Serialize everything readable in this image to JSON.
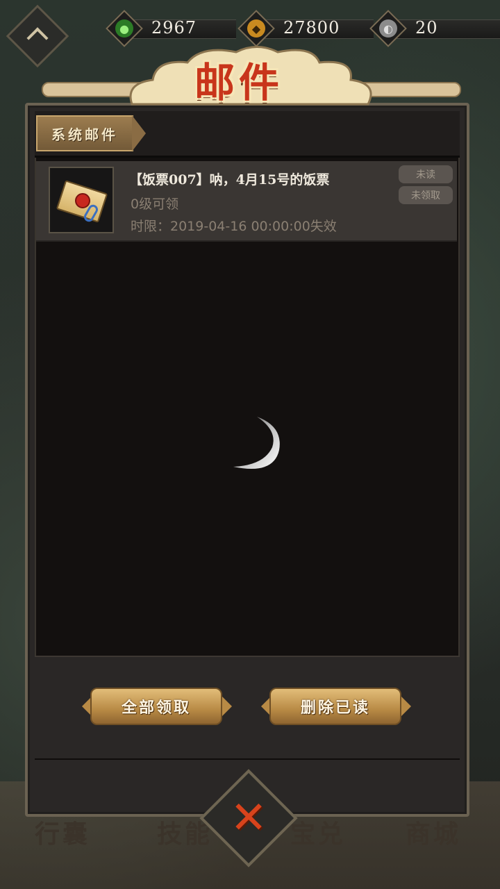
{
  "header": {
    "title": "邮件",
    "resources": [
      {
        "icon": "leaf-gem-icon",
        "color": "#4caf3c",
        "value": "2967"
      },
      {
        "icon": "gold-coin-icon",
        "color": "#d99a2b",
        "value": "27800"
      },
      {
        "icon": "silver-coin-icon",
        "color": "#8c8c8c",
        "value": "20"
      }
    ]
  },
  "tabs": [
    {
      "label": "系统邮件"
    }
  ],
  "mail": {
    "title": "【饭票007】呐，4月15号的饭票",
    "level": "0级可领",
    "expire": "时限：2019-04-16 00:00:00失效",
    "status_read": "未读",
    "status_claim": "未领取"
  },
  "footer": {
    "claim_all": "全部领取",
    "delete_read": "删除已读"
  },
  "background": {
    "bottom_labels": [
      "行囊",
      "技能",
      "宝兑",
      "商城"
    ]
  },
  "colors": {
    "accent_gold": "#c8a66d",
    "title_red": "#c8351b",
    "close_red": "#d8431c"
  }
}
